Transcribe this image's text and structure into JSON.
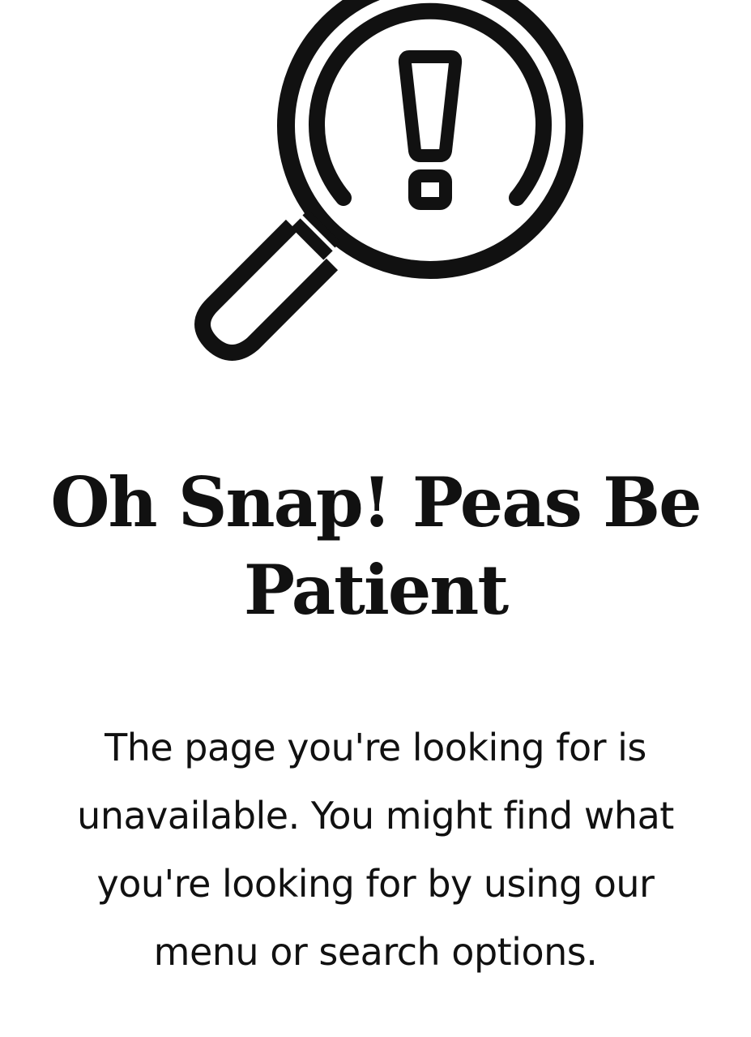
{
  "error_page": {
    "icon": "magnifier-exclamation-icon",
    "title": "Oh Snap! Peas Be Patient",
    "message": "The page you're looking for is unavailable. You might find what you're looking for by using our menu or search options."
  },
  "colors": {
    "background": "#ffffff",
    "text": "#111111",
    "icon_stroke": "#111111"
  }
}
